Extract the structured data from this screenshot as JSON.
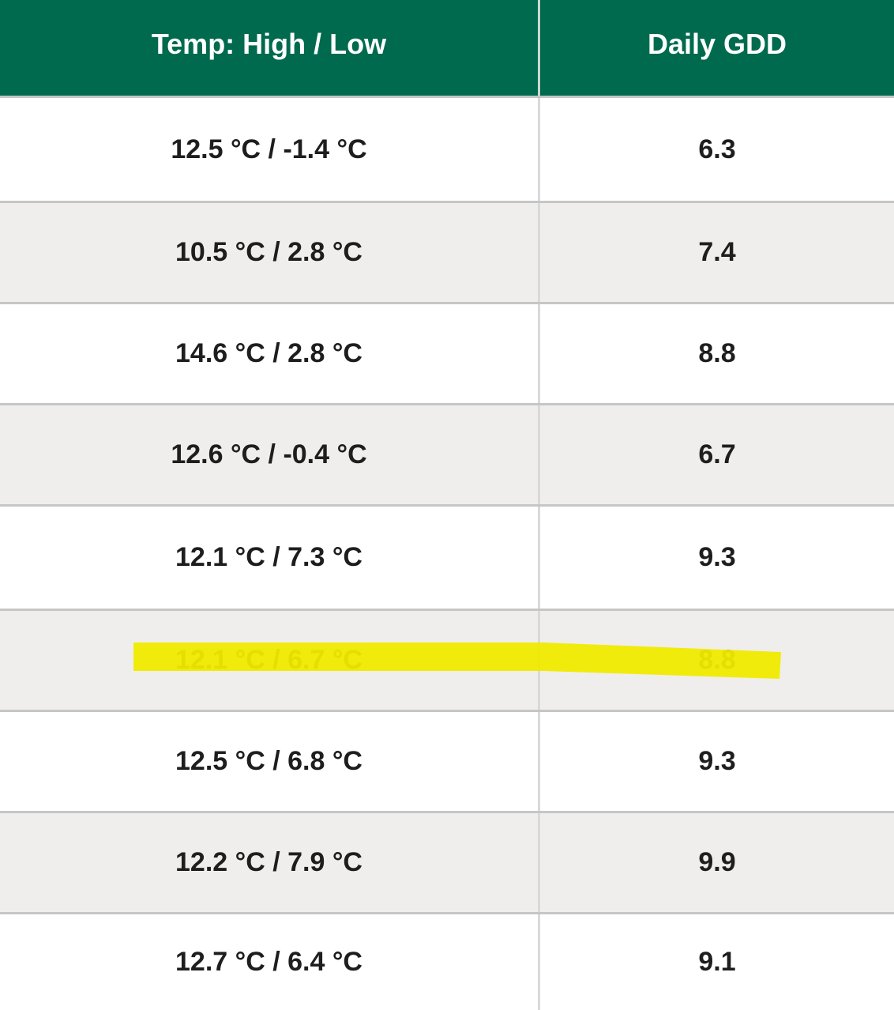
{
  "table": {
    "headers": {
      "temp": "Temp: High / Low",
      "gdd": "Daily GDD"
    },
    "rows": [
      {
        "temp": "12.5 °C / -1.4 °C",
        "gdd": "6.3"
      },
      {
        "temp": "10.5 °C / 2.8 °C",
        "gdd": "7.4"
      },
      {
        "temp": "14.6 °C / 2.8 °C",
        "gdd": "8.8"
      },
      {
        "temp": "12.6 °C / -0.4 °C",
        "gdd": "6.7"
      },
      {
        "temp": "12.1 °C / 7.3 °C",
        "gdd": "9.3"
      },
      {
        "temp": "12.1 °C / 6.7 °C",
        "gdd": "8.8",
        "highlighted": true
      },
      {
        "temp": "12.5 °C / 6.8 °C",
        "gdd": "9.3"
      },
      {
        "temp": "12.2 °C / 7.9 °C",
        "gdd": "9.9"
      },
      {
        "temp": "12.7 °C / 6.4 °C",
        "gdd": "9.1"
      }
    ]
  },
  "colors": {
    "header_bg": "#006A4E",
    "row_alt_bg": "#efeeec",
    "highlight": "#f0ea00"
  }
}
